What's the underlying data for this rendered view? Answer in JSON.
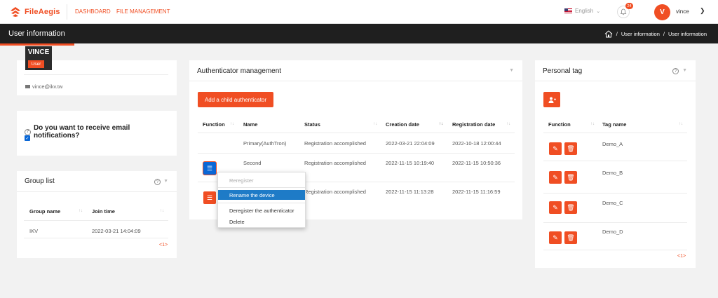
{
  "app": {
    "logo_text": "FileAegis"
  },
  "nav": {
    "dashboard": "DASHBOARD",
    "file_management": "FILE MANAGEMENT"
  },
  "header": {
    "language": "English",
    "notification_count": "24",
    "avatar_initial": "V",
    "user_name": "vince"
  },
  "titlebar": {
    "title": "User information",
    "breadcrumb": [
      "User information",
      "User information"
    ]
  },
  "user_card": {
    "name": "VINCE",
    "role": "User",
    "email": "vince@ikv.tw"
  },
  "notification_card": {
    "question": "Do you want to receive email notifications?",
    "checked": true
  },
  "group_card": {
    "title": "Group list",
    "columns": [
      "Group name",
      "Join time"
    ],
    "rows": [
      {
        "group_name": "IKV",
        "join_time": "2022-03-21 14:04:09"
      }
    ],
    "pager": "<1>"
  },
  "auth_card": {
    "title": "Authenticator management",
    "add_button": "Add a child authenticator",
    "columns": [
      "Function",
      "Name",
      "Status",
      "Creation date",
      "Registration date"
    ],
    "rows": [
      {
        "name": "Primary(AuthTron)",
        "status": "Registration accomplished",
        "created": "2022-03-21 22:04:09",
        "registered": "2022-10-18 12:00:44"
      },
      {
        "name": "Second",
        "status": "Registration accomplished",
        "created": "2022-11-15 10:19:40",
        "registered": "2022-11-15 10:50:36"
      },
      {
        "name": "",
        "status": "Registration accomplished",
        "created": "2022-11-15 11:13:28",
        "registered": "2022-11-15 11:16:59"
      }
    ],
    "menu": {
      "reregister": "Reregister",
      "rename": "Rename the device",
      "deregister": "Deregister the authenticator",
      "delete": "Delete"
    }
  },
  "tag_card": {
    "title": "Personal tag",
    "columns": [
      "Function",
      "Tag name"
    ],
    "tags": [
      "Demo_A",
      "Demo_B",
      "Demo_C",
      "Demo_D"
    ],
    "pager": "<1>"
  },
  "colors": {
    "accent": "#f04e23",
    "dark": "#1f1f1f",
    "selected": "#1e7bc7",
    "menu_button": "#0a67d6"
  },
  "icons": {
    "logo": "shield-logo-icon",
    "bell": "bell-icon",
    "home": "home-icon",
    "mail": "mail-icon",
    "help": "help-circle-icon",
    "menu": "hamburger-menu-icon",
    "edit": "edit-icon",
    "delete": "trash-icon",
    "add_user": "add-user-icon"
  }
}
